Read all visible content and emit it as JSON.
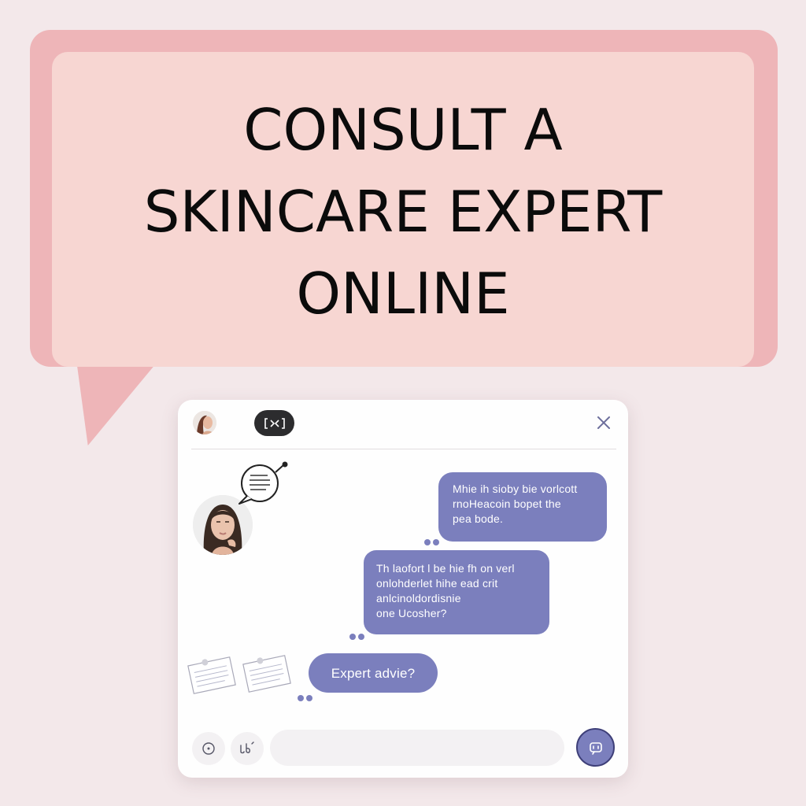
{
  "banner": {
    "title_lines": [
      "CONSULT A",
      "SKINCARE EXPERT",
      "ONLINE"
    ]
  },
  "chat": {
    "messages": [
      {
        "lines": [
          "Mhie ih sioby  bie vorlcott",
          "rnoHeacoin bopet  the",
          "pea bode."
        ]
      },
      {
        "lines": [
          "Th laofort l be hie fh on verl",
          "onlohderlet hihe ead crit",
          "anlcinoldordisnie",
          "one Ucosher?"
        ]
      },
      {
        "lines": [
          "Expert advie?"
        ]
      }
    ],
    "input": {
      "value": "",
      "placeholder": ""
    }
  },
  "icons": {
    "header_control": "expand-icon",
    "close": "close-icon",
    "thought": "thought-bubble-icon",
    "emoji": "emoji-icon",
    "voice": "voice-icon",
    "send": "send-icon"
  },
  "colors": {
    "background": "#f3e8ea",
    "banner_back": "#eeb5b8",
    "banner_front": "#f7d6d2",
    "bubble": "#7b7fbd",
    "header_pill": "#2c2c2e"
  }
}
